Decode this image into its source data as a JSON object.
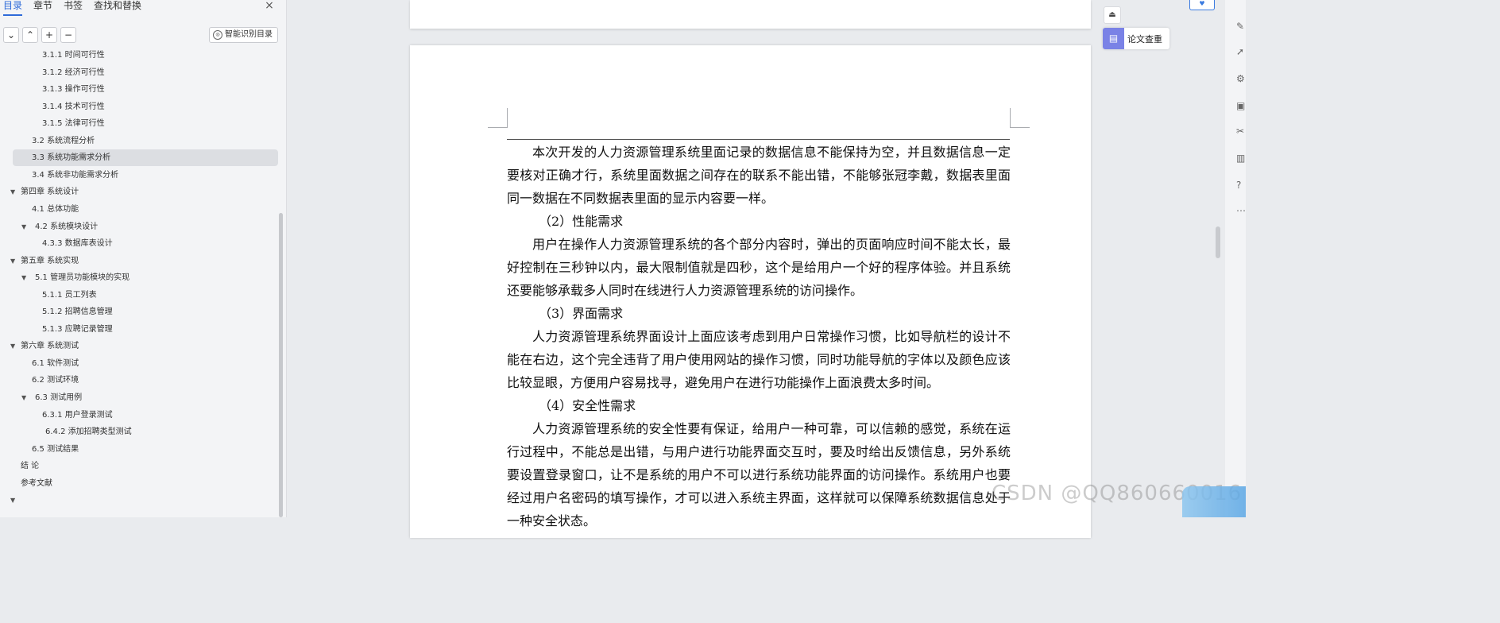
{
  "sidebar": {
    "tabs": [
      "目录",
      "章节",
      "书签",
      "查找和替换"
    ],
    "close_icon": "×",
    "toolbar": {
      "collapse": "⌄",
      "expand": "⌃",
      "add": "+",
      "remove": "−",
      "smart_toc": "智能识别目录"
    },
    "toc": [
      {
        "label": "3.1.1 时间可行性",
        "level": 3
      },
      {
        "label": "3.1.2 经济可行性",
        "level": 3
      },
      {
        "label": "3.1.3 操作可行性",
        "level": 3
      },
      {
        "label": "3.1.4 技术可行性",
        "level": 3
      },
      {
        "label": "3.1.5 法律可行性",
        "level": 3
      },
      {
        "label": "3.2 系统流程分析",
        "level": 2
      },
      {
        "label": "3.3 系统功能需求分析",
        "level": 2,
        "selected": true
      },
      {
        "label": "3.4 系统非功能需求分析",
        "level": 2
      },
      {
        "label": "第四章 系统设计",
        "level": 1,
        "caret": true
      },
      {
        "label": "4.1 总体功能",
        "level": 2
      },
      {
        "label": "4.2 系统模块设计",
        "level": 2,
        "caret": true
      },
      {
        "label": "4.3.3 数据库表设计",
        "level": 3
      },
      {
        "label": "第五章 系统实现",
        "level": 1,
        "caret": true
      },
      {
        "label": "5.1 管理员功能模块的实现",
        "level": 2,
        "caret": true
      },
      {
        "label": "5.1.1 员工列表",
        "level": 3
      },
      {
        "label": "5.1.2 招聘信息管理",
        "level": 3
      },
      {
        "label": "5.1.3 应聘记录管理",
        "level": 3
      },
      {
        "label": "第六章 系统测试",
        "level": 1,
        "caret": true
      },
      {
        "label": "6.1 软件测试",
        "level": 2
      },
      {
        "label": "6.2 测试环境",
        "level": 2
      },
      {
        "label": "6.3 测试用例",
        "level": 2,
        "caret": true
      },
      {
        "label": "6.3.1 用户登录测试",
        "level": 3
      },
      {
        "label": "6.4.2 添加招聘类型测试",
        "level": 3
      },
      {
        "label": "6.5 测试结果",
        "level": 2
      },
      {
        "label": "结 论",
        "level": 1
      },
      {
        "label": "参考文献",
        "level": 1
      },
      {
        "label": "",
        "level": 1,
        "caret": true
      }
    ]
  },
  "document": {
    "paragraphs": [
      {
        "text": "本次开发的人力资源管理系统里面记录的数据信息不能保持为空，并且数据信息一定要核对正确才行，系统里面数据之间存在的联系不能出错，不能够张冠李戴，数据表里面同一数据在不同数据表里面的显示内容要一样。",
        "heading": false
      },
      {
        "text": "（2）性能需求",
        "heading": true
      },
      {
        "text": "用户在操作人力资源管理系统的各个部分内容时，弹出的页面响应时间不能太长，最好控制在三秒钟以内，最大限制值就是四秒，这个是给用户一个好的程序体验。并且系统还要能够承载多人同时在线进行人力资源管理系统的访问操作。",
        "heading": false
      },
      {
        "text": "（3）界面需求",
        "heading": true
      },
      {
        "text": "人力资源管理系统界面设计上面应该考虑到用户日常操作习惯，比如导航栏的设计不能在右边，这个完全违背了用户使用网站的操作习惯，同时功能导航的字体以及颜色应该比较显眼，方便用户容易找寻，避免用户在进行功能操作上面浪费太多时间。",
        "heading": false
      },
      {
        "text": "（4）安全性需求",
        "heading": true
      },
      {
        "text": "人力资源管理系统的安全性要有保证，给用户一种可靠，可以信赖的感觉，系统在运行过程中，不能总是出错，与用户进行功能界面交互时，要及时给出反馈信息，另外系统要设置登录窗口，让不是系统的用户不可以进行系统功能界面的访问操作。系统用户也要经过用户名密码的填写操作，才可以进入系统主界面，这样就可以保障系统数据信息处于一种安全状态。",
        "heading": false
      }
    ]
  },
  "right_panel": {
    "paper_check": "论文查重",
    "paper_check_icon": "document-check-icon"
  },
  "watermark": "CSDN @QQ860660016"
}
